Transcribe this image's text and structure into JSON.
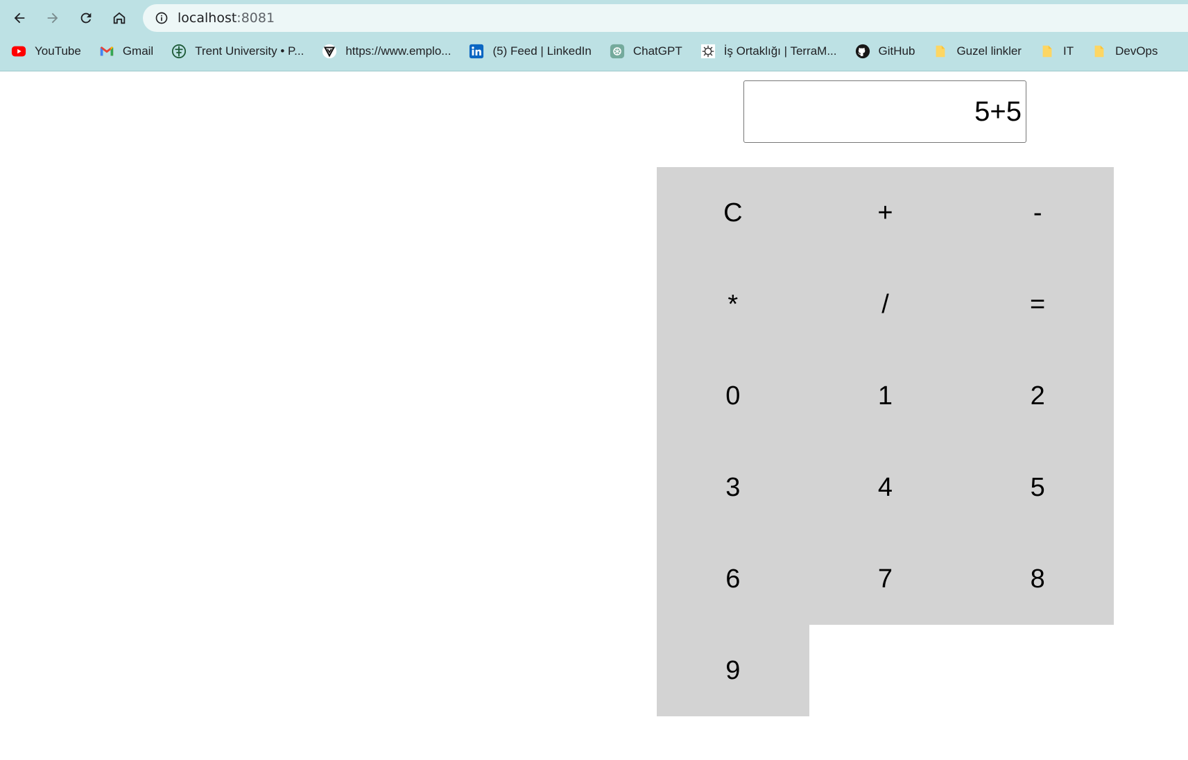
{
  "browser": {
    "url_host": "localhost",
    "url_port": ":8081",
    "bookmarks": [
      {
        "label": "YouTube",
        "icon": "youtube-icon"
      },
      {
        "label": "Gmail",
        "icon": "gmail-icon"
      },
      {
        "label": "Trent University • P...",
        "icon": "trent-university-icon"
      },
      {
        "label": "https://www.emplo...",
        "icon": "employer-site-icon"
      },
      {
        "label": "(5) Feed | LinkedIn",
        "icon": "linkedin-icon"
      },
      {
        "label": "ChatGPT",
        "icon": "chatgpt-icon"
      },
      {
        "label": "İş Ortaklığı | TerraM...",
        "icon": "terram-icon"
      },
      {
        "label": "GitHub",
        "icon": "github-icon"
      },
      {
        "label": "Guzel linkler",
        "icon": "folder-icon"
      },
      {
        "label": "IT",
        "icon": "folder-icon"
      },
      {
        "label": "DevOps",
        "icon": "folder-icon"
      }
    ],
    "colors": {
      "toolbar": "#bde1e4",
      "omnibox": "#edf7f7"
    }
  },
  "calculator": {
    "display_value": "5+5",
    "keys": [
      "C",
      "+",
      "-",
      "*",
      "/",
      "=",
      "0",
      "1",
      "2",
      "3",
      "4",
      "5",
      "6",
      "7",
      "8",
      "9"
    ],
    "colors": {
      "key_background": "#d3d3d3"
    }
  }
}
